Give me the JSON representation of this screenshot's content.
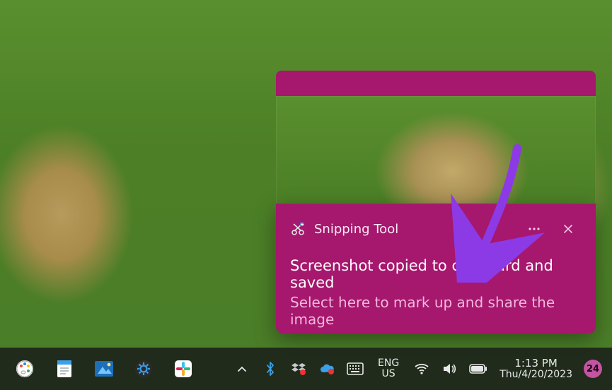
{
  "annotation": {
    "stroke": "#8c3ae6"
  },
  "notification": {
    "accent": "#a6176e",
    "app_name": "Snipping Tool",
    "title": "Screenshot copied to clipboard and saved",
    "body": "Select here to mark up and share the image",
    "more_icon": "more-horizontal-icon",
    "close_icon": "close-icon",
    "appicon": "snipping-tool-icon"
  },
  "taskbar": {
    "pinned": [
      {
        "name": "paint-app-icon"
      },
      {
        "name": "notepad-app-icon"
      },
      {
        "name": "photos-app-icon"
      },
      {
        "name": "settings-app-icon"
      },
      {
        "name": "slack-app-icon"
      }
    ],
    "overflow_icon": "chevron-up-icon",
    "tray": {
      "icons": [
        "bluetooth-icon",
        "dropbox-icon",
        "onedrive-icon",
        "touch-keyboard-icon"
      ],
      "language_top": "ENG",
      "language_bottom": "US",
      "wifi_icon": "wifi-icon",
      "volume_icon": "volume-icon",
      "battery_icon": "battery-icon",
      "time": "1:13 PM",
      "date": "Thu/4/20/2023",
      "notification_count": "24"
    }
  }
}
